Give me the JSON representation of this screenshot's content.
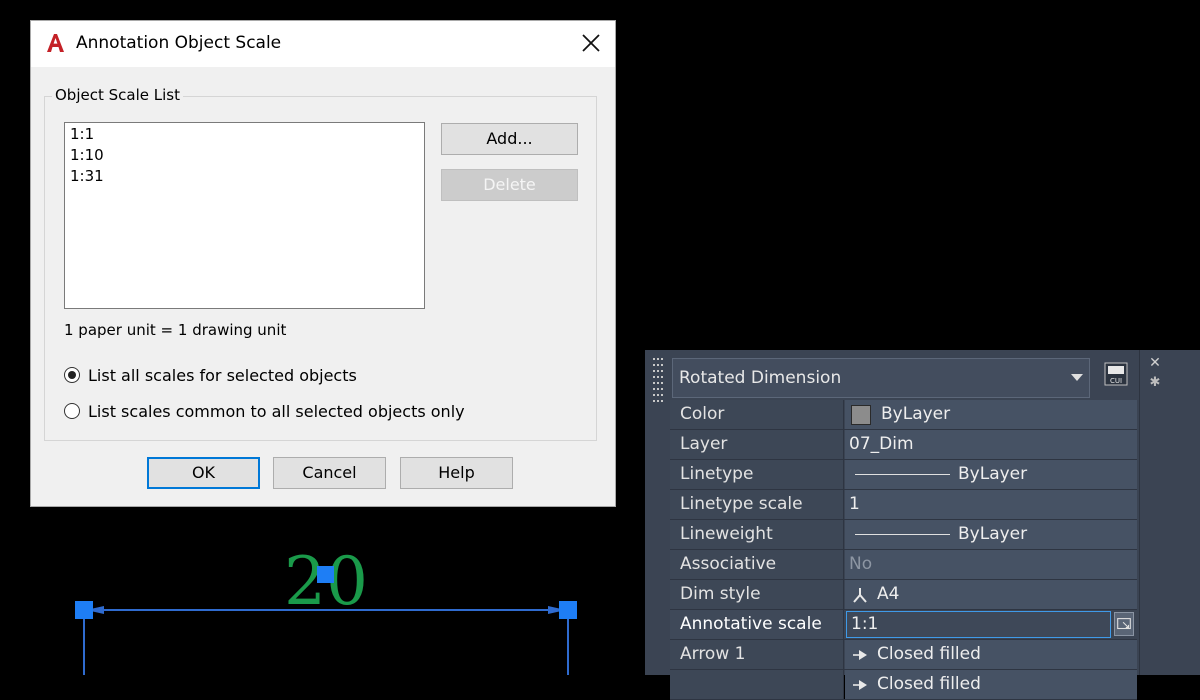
{
  "dialog": {
    "title": "Annotation Object Scale",
    "group_label": "Object Scale List",
    "scales": [
      "1:1",
      "1:10",
      "1:31"
    ],
    "add_label": "Add...",
    "delete_label": "Delete",
    "units_text": "1 paper unit = 1 drawing unit",
    "radio_all": "List all scales for selected objects",
    "radio_common": "List scales common to all selected objects only",
    "radio_selected": "radio_all",
    "ok_label": "OK",
    "cancel_label": "Cancel",
    "help_label": "Help"
  },
  "drawing": {
    "dimension_text": "20",
    "text_color": "#1a9a4a",
    "line_color": "#2f6bcf",
    "grip_color": "#1e7ef5"
  },
  "properties": {
    "object_type": "Rotated Dimension",
    "rows": [
      {
        "name": "Color",
        "value": "ByLayer"
      },
      {
        "name": "Layer",
        "value": "07_Dim"
      },
      {
        "name": "Linetype",
        "value": "ByLayer"
      },
      {
        "name": "Linetype scale",
        "value": "1"
      },
      {
        "name": "Lineweight",
        "value": "ByLayer"
      },
      {
        "name": "Associative",
        "value": "No"
      },
      {
        "name": "Dim style",
        "value": "A4"
      },
      {
        "name": "Annotative scale",
        "value": "1:1"
      },
      {
        "name": "Arrow 1",
        "value": "Closed filled"
      },
      {
        "name": "",
        "value": "Closed filled"
      }
    ]
  }
}
